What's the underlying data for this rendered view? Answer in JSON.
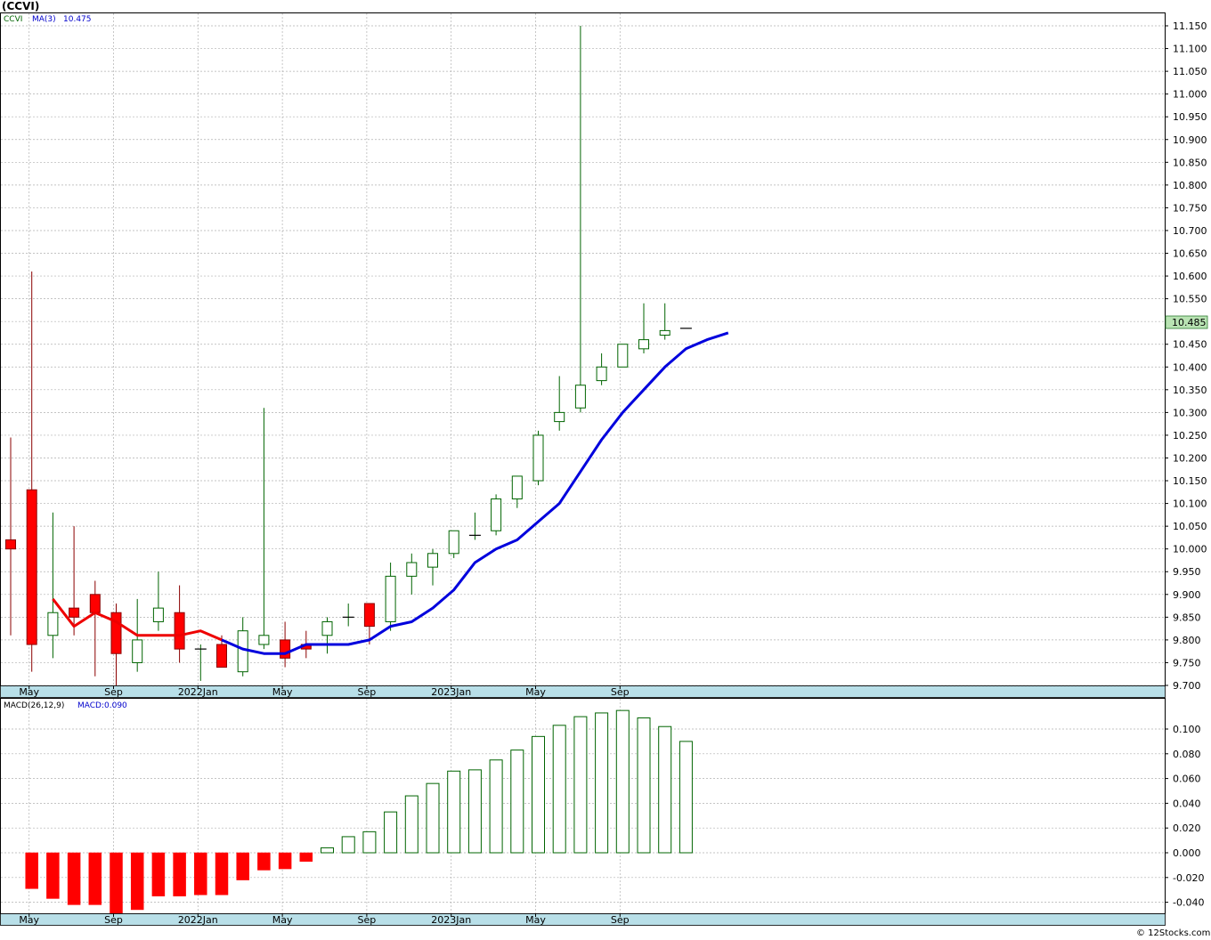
{
  "ticker_title": "(CCVI)",
  "copyright": "© 12Stocks.com",
  "colors": {
    "up": "#006400",
    "down": "#ff0000",
    "ma_up": "#0000dd",
    "ma_down": "#ee0000",
    "axis_band": "#b8dfe8",
    "last_price_box": "#b9e3b3"
  },
  "price_panel": {
    "legend": [
      {
        "text": "CCVI",
        "color": "#006400"
      },
      {
        "text": "MA(3)",
        "color": "#0000cc"
      },
      {
        "text": "10.475",
        "color": "#0000cc"
      }
    ],
    "last_price_label": "10.485",
    "y_tick_labels": [
      "11.150",
      "11.100",
      "11.050",
      "11.000",
      "10.950",
      "10.900",
      "10.850",
      "10.800",
      "10.750",
      "10.700",
      "10.650",
      "10.600",
      "10.550",
      "10.500",
      "10.450",
      "10.400",
      "10.350",
      "10.300",
      "10.250",
      "10.200",
      "10.150",
      "10.100",
      "10.050",
      "10.000",
      "9.950",
      "9.900",
      "9.850",
      "9.800",
      "9.750",
      "9.700"
    ],
    "x_tick_labels": [
      "May",
      "Sep",
      "2022Jan",
      "May",
      "Sep",
      "2023Jan",
      "May",
      "Sep"
    ]
  },
  "macd_panel": {
    "legend": [
      {
        "text": "MACD(26,12,9)",
        "color": "#000000"
      },
      {
        "text": "MACD:0.090",
        "color": "#0000cc"
      }
    ],
    "y_tick_labels": [
      "0.100",
      "0.080",
      "0.060",
      "0.040",
      "0.020",
      "0.000",
      "-0.020",
      "-0.040"
    ],
    "x_tick_labels": [
      "May",
      "Sep",
      "2022Jan",
      "May",
      "Sep",
      "2023Jan",
      "May",
      "Sep"
    ]
  },
  "chart_data": [
    {
      "type": "candlestick",
      "title": "(CCVI)",
      "interval": "monthly",
      "ylim": [
        9.7,
        11.15
      ],
      "y_scale": "linear",
      "grid": true,
      "x_tick_labels": [
        "May",
        "Sep",
        "2022Jan",
        "May",
        "Sep",
        "2023Jan",
        "May",
        "Sep"
      ],
      "candles": [
        {
          "o": 10.02,
          "h": 10.245,
          "l": 9.81,
          "c": 10.0
        },
        {
          "o": 10.13,
          "h": 10.61,
          "l": 9.73,
          "c": 9.79
        },
        {
          "o": 9.81,
          "h": 10.08,
          "l": 9.76,
          "c": 9.86
        },
        {
          "o": 9.87,
          "h": 10.05,
          "l": 9.81,
          "c": 9.85
        },
        {
          "o": 9.9,
          "h": 9.93,
          "l": 9.72,
          "c": 9.86
        },
        {
          "o": 9.86,
          "h": 9.88,
          "l": 9.7,
          "c": 9.77
        },
        {
          "o": 9.75,
          "h": 9.89,
          "l": 9.73,
          "c": 9.8
        },
        {
          "o": 9.84,
          "h": 9.95,
          "l": 9.82,
          "c": 9.87
        },
        {
          "o": 9.86,
          "h": 9.92,
          "l": 9.75,
          "c": 9.78
        },
        {
          "o": 9.78,
          "h": 9.79,
          "l": 9.71,
          "c": 9.78
        },
        {
          "o": 9.79,
          "h": 9.81,
          "l": 9.76,
          "c": 9.74
        },
        {
          "o": 9.73,
          "h": 9.85,
          "l": 9.72,
          "c": 9.82
        },
        {
          "o": 9.79,
          "h": 10.31,
          "l": 9.78,
          "c": 9.81
        },
        {
          "o": 9.8,
          "h": 9.84,
          "l": 9.74,
          "c": 9.76
        },
        {
          "o": 9.79,
          "h": 9.82,
          "l": 9.76,
          "c": 9.78
        },
        {
          "o": 9.81,
          "h": 9.85,
          "l": 9.77,
          "c": 9.84
        },
        {
          "o": 9.85,
          "h": 9.88,
          "l": 9.83,
          "c": 9.85
        },
        {
          "o": 9.88,
          "h": 9.88,
          "l": 9.79,
          "c": 9.83
        },
        {
          "o": 9.84,
          "h": 9.97,
          "l": 9.82,
          "c": 9.94
        },
        {
          "o": 9.94,
          "h": 9.99,
          "l": 9.9,
          "c": 9.97
        },
        {
          "o": 9.96,
          "h": 10.0,
          "l": 9.92,
          "c": 9.99
        },
        {
          "o": 9.99,
          "h": 10.04,
          "l": 9.98,
          "c": 10.04
        },
        {
          "o": 10.03,
          "h": 10.08,
          "l": 10.02,
          "c": 10.03
        },
        {
          "o": 10.04,
          "h": 10.12,
          "l": 10.03,
          "c": 10.11
        },
        {
          "o": 10.11,
          "h": 10.16,
          "l": 10.09,
          "c": 10.16
        },
        {
          "o": 10.15,
          "h": 10.26,
          "l": 10.14,
          "c": 10.25
        },
        {
          "o": 10.28,
          "h": 10.38,
          "l": 10.26,
          "c": 10.3
        },
        {
          "o": 10.31,
          "h": 11.15,
          "l": 10.3,
          "c": 10.36
        },
        {
          "o": 10.37,
          "h": 10.43,
          "l": 10.36,
          "c": 10.4
        },
        {
          "o": 10.4,
          "h": 10.45,
          "l": 10.4,
          "c": 10.45
        },
        {
          "o": 10.44,
          "h": 10.54,
          "l": 10.43,
          "c": 10.46
        },
        {
          "o": 10.47,
          "h": 10.54,
          "l": 10.46,
          "c": 10.48
        },
        {
          "o": 10.485,
          "h": 10.485,
          "l": 10.485,
          "c": 10.485
        }
      ],
      "ma3": [
        9.89,
        9.83,
        9.86,
        9.84,
        9.81,
        9.81,
        9.81,
        9.82,
        9.8,
        9.78,
        9.77,
        9.77,
        9.79,
        9.79,
        9.79,
        9.8,
        9.83,
        9.84,
        9.87,
        9.91,
        9.97,
        10.0,
        10.02,
        10.06,
        10.1,
        10.17,
        10.24,
        10.3,
        10.35,
        10.4,
        10.44,
        10.46,
        10.475
      ],
      "ma3_start_index": 2,
      "ma3_down_until_index": 10
    },
    {
      "type": "bar",
      "title": "MACD(26,12,9)",
      "ylim": [
        -0.048,
        0.115
      ],
      "grid": true,
      "series": [
        {
          "name": "MACD(26,12,9)",
          "values": [
            -0.029,
            -0.037,
            -0.042,
            -0.042,
            -0.049,
            -0.046,
            -0.035,
            -0.035,
            -0.034,
            -0.034,
            -0.022,
            -0.014,
            -0.013,
            -0.007,
            0.004,
            0.013,
            0.017,
            0.033,
            0.046,
            0.056,
            0.066,
            0.067,
            0.075,
            0.083,
            0.094,
            0.103,
            0.11,
            0.113,
            0.115,
            0.109,
            0.102,
            0.09
          ]
        }
      ]
    }
  ]
}
